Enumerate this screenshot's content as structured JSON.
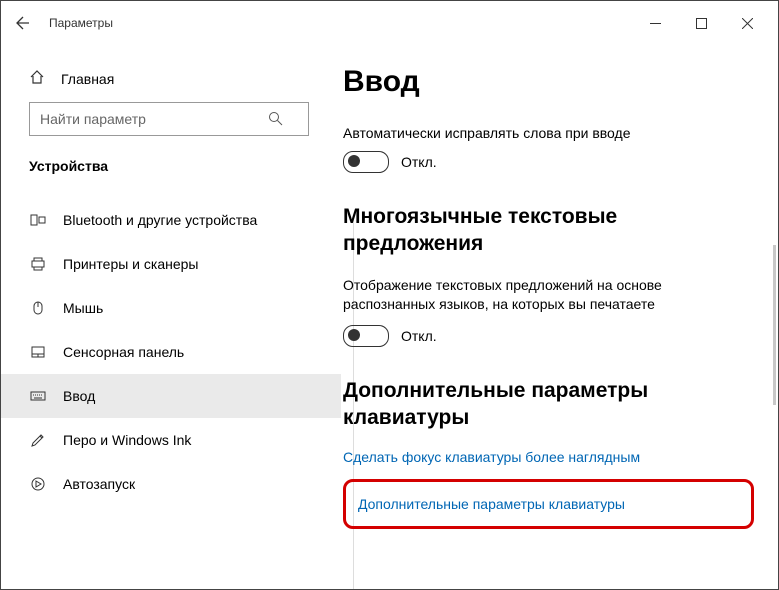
{
  "window": {
    "title": "Параметры"
  },
  "sidebar": {
    "home": "Главная",
    "search_placeholder": "Найти параметр",
    "category": "Устройства",
    "items": [
      {
        "label": "Bluetooth и другие устройства"
      },
      {
        "label": "Принтеры и сканеры"
      },
      {
        "label": "Мышь"
      },
      {
        "label": "Сенсорная панель"
      },
      {
        "label": "Ввод"
      },
      {
        "label": "Перо и Windows Ink"
      },
      {
        "label": "Автозапуск"
      }
    ]
  },
  "main": {
    "heading": "Ввод",
    "autocorrect_label": "Автоматически исправлять слова при вводе",
    "toggle_off": "Откл.",
    "multilang_heading": "Многоязычные текстовые предложения",
    "multilang_desc": "Отображение текстовых предложений на основе распознанных языков, на которых вы печатаете",
    "extra_heading": "Дополнительные параметры клавиатуры",
    "link_focus": "Сделать фокус клавиатуры более наглядным",
    "link_advanced": "Дополнительные параметры клавиатуры"
  }
}
